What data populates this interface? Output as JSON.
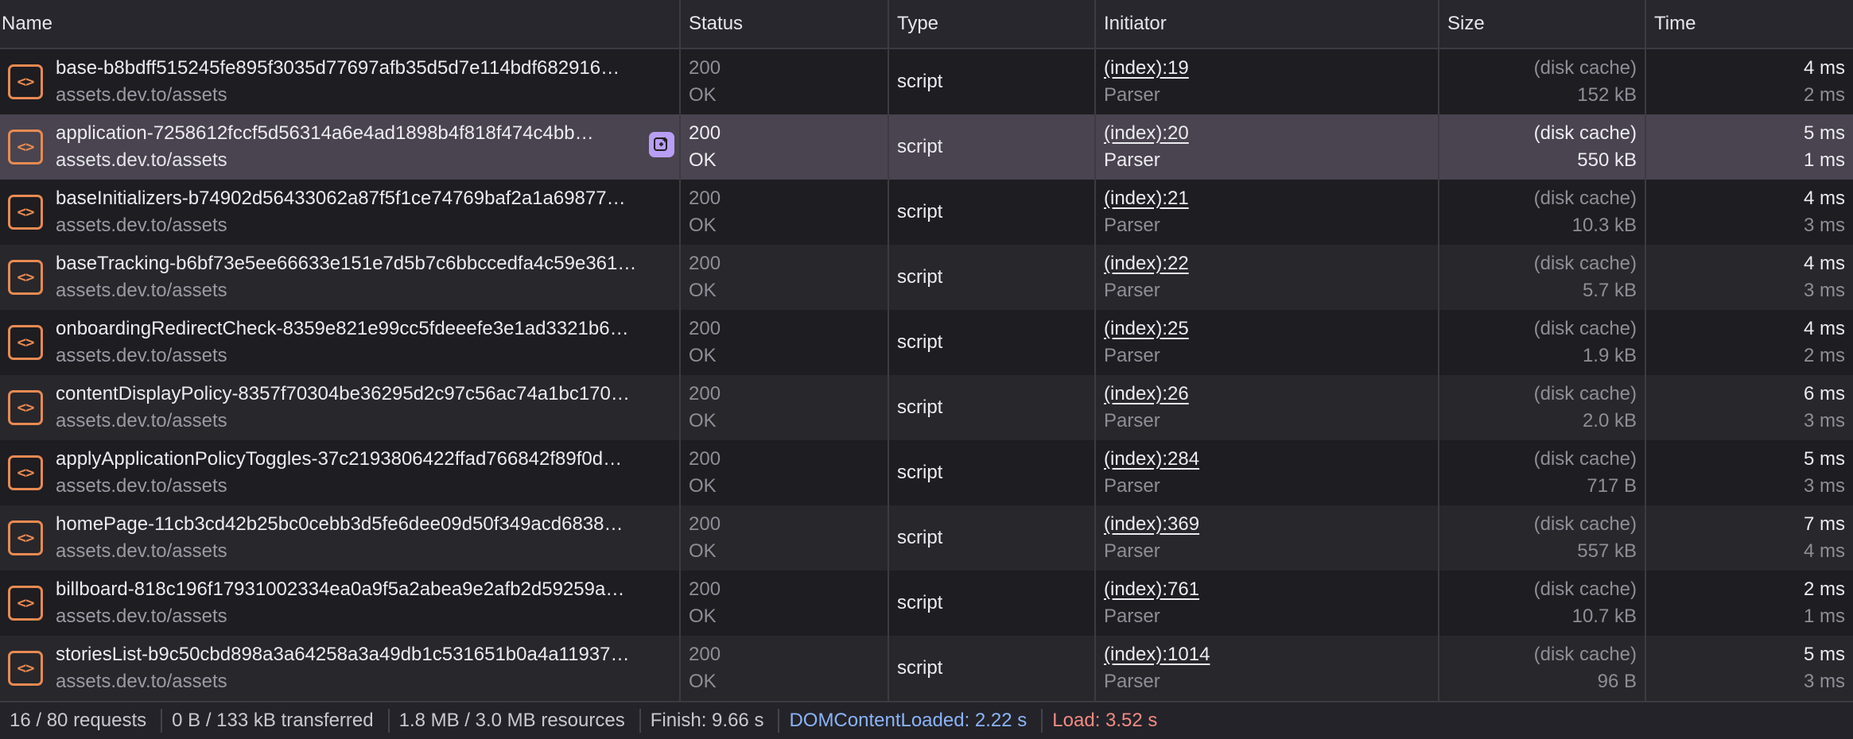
{
  "columns": {
    "name": "Name",
    "status": "Status",
    "type": "Type",
    "initiator": "Initiator",
    "size": "Size",
    "time": "Time"
  },
  "rows": [
    {
      "name": "base-b8bdff515245fe895f3035d77697afb35d5d7e114bdf682916…",
      "domain": "assets.dev.to/assets",
      "status_code": "200",
      "status_text": "OK",
      "type": "script",
      "initiator": "(index):19",
      "initiator_type": "Parser",
      "size_transferred": "(disk cache)",
      "size_resource": "152 kB",
      "time_total": "4 ms",
      "time_latency": "2 ms"
    },
    {
      "name": "application-7258612fccf5d56314a6e4ad1898b4f818f474c4bb…",
      "domain": "assets.dev.to/assets",
      "status_code": "200",
      "status_text": "OK",
      "type": "script",
      "initiator": "(index):20",
      "initiator_type": "Parser",
      "size_transferred": "(disk cache)",
      "size_resource": "550 kB",
      "time_total": "5 ms",
      "time_latency": "1 ms",
      "selected": true
    },
    {
      "name": "baseInitializers-b74902d56433062a87f5f1ce74769baf2a1a69877…",
      "domain": "assets.dev.to/assets",
      "status_code": "200",
      "status_text": "OK",
      "type": "script",
      "initiator": "(index):21",
      "initiator_type": "Parser",
      "size_transferred": "(disk cache)",
      "size_resource": "10.3 kB",
      "time_total": "4 ms",
      "time_latency": "3 ms"
    },
    {
      "name": "baseTracking-b6bf73e5ee66633e151e7d5b7c6bbccedfa4c59e361…",
      "domain": "assets.dev.to/assets",
      "status_code": "200",
      "status_text": "OK",
      "type": "script",
      "initiator": "(index):22",
      "initiator_type": "Parser",
      "size_transferred": "(disk cache)",
      "size_resource": "5.7 kB",
      "time_total": "4 ms",
      "time_latency": "3 ms"
    },
    {
      "name": "onboardingRedirectCheck-8359e821e99cc5fdeeefe3e1ad3321b6…",
      "domain": "assets.dev.to/assets",
      "status_code": "200",
      "status_text": "OK",
      "type": "script",
      "initiator": "(index):25",
      "initiator_type": "Parser",
      "size_transferred": "(disk cache)",
      "size_resource": "1.9 kB",
      "time_total": "4 ms",
      "time_latency": "2 ms"
    },
    {
      "name": "contentDisplayPolicy-8357f70304be36295d2c97c56ac74a1bc170…",
      "domain": "assets.dev.to/assets",
      "status_code": "200",
      "status_text": "OK",
      "type": "script",
      "initiator": "(index):26",
      "initiator_type": "Parser",
      "size_transferred": "(disk cache)",
      "size_resource": "2.0 kB",
      "time_total": "6 ms",
      "time_latency": "3 ms"
    },
    {
      "name": "applyApplicationPolicyToggles-37c2193806422ffad766842f89f0d…",
      "domain": "assets.dev.to/assets",
      "status_code": "200",
      "status_text": "OK",
      "type": "script",
      "initiator": "(index):284",
      "initiator_type": "Parser",
      "size_transferred": "(disk cache)",
      "size_resource": "717 B",
      "time_total": "5 ms",
      "time_latency": "3 ms"
    },
    {
      "name": "homePage-11cb3cd42b25bc0cebb3d5fe6dee09d50f349acd6838…",
      "domain": "assets.dev.to/assets",
      "status_code": "200",
      "status_text": "OK",
      "type": "script",
      "initiator": "(index):369",
      "initiator_type": "Parser",
      "size_transferred": "(disk cache)",
      "size_resource": "557 kB",
      "time_total": "7 ms",
      "time_latency": "4 ms"
    },
    {
      "name": "billboard-818c196f17931002334ea0a9f5a2abea9e2afb2d59259a…",
      "domain": "assets.dev.to/assets",
      "status_code": "200",
      "status_text": "OK",
      "type": "script",
      "initiator": "(index):761",
      "initiator_type": "Parser",
      "size_transferred": "(disk cache)",
      "size_resource": "10.7 kB",
      "time_total": "2 ms",
      "time_latency": "1 ms"
    },
    {
      "name": "storiesList-b9c50cbd898a3a64258a3a49db1c531651b0a4a11937…",
      "domain": "assets.dev.to/assets",
      "status_code": "200",
      "status_text": "OK",
      "type": "script",
      "initiator": "(index):1014",
      "initiator_type": "Parser",
      "size_transferred": "(disk cache)",
      "size_resource": "96 B",
      "time_total": "5 ms",
      "time_latency": "3 ms"
    }
  ],
  "icons": {
    "file": "script-file-icon",
    "file_glyph": "<>",
    "ai": "ai-assistance-icon"
  },
  "colors": {
    "icon_accent": "#e88a52",
    "selected_row": "#49444f",
    "ai_badge": "#b89ef5",
    "dom_content_loaded": "#8ab4f8",
    "load": "#f28b82"
  },
  "footer": {
    "requests": "16 / 80 requests",
    "transferred": "0 B / 133 kB transferred",
    "resources": "1.8 MB / 3.0 MB resources",
    "finish": "Finish: 9.66 s",
    "dom_content_loaded": "DOMContentLoaded: 2.22 s",
    "load": "Load: 3.52 s"
  }
}
